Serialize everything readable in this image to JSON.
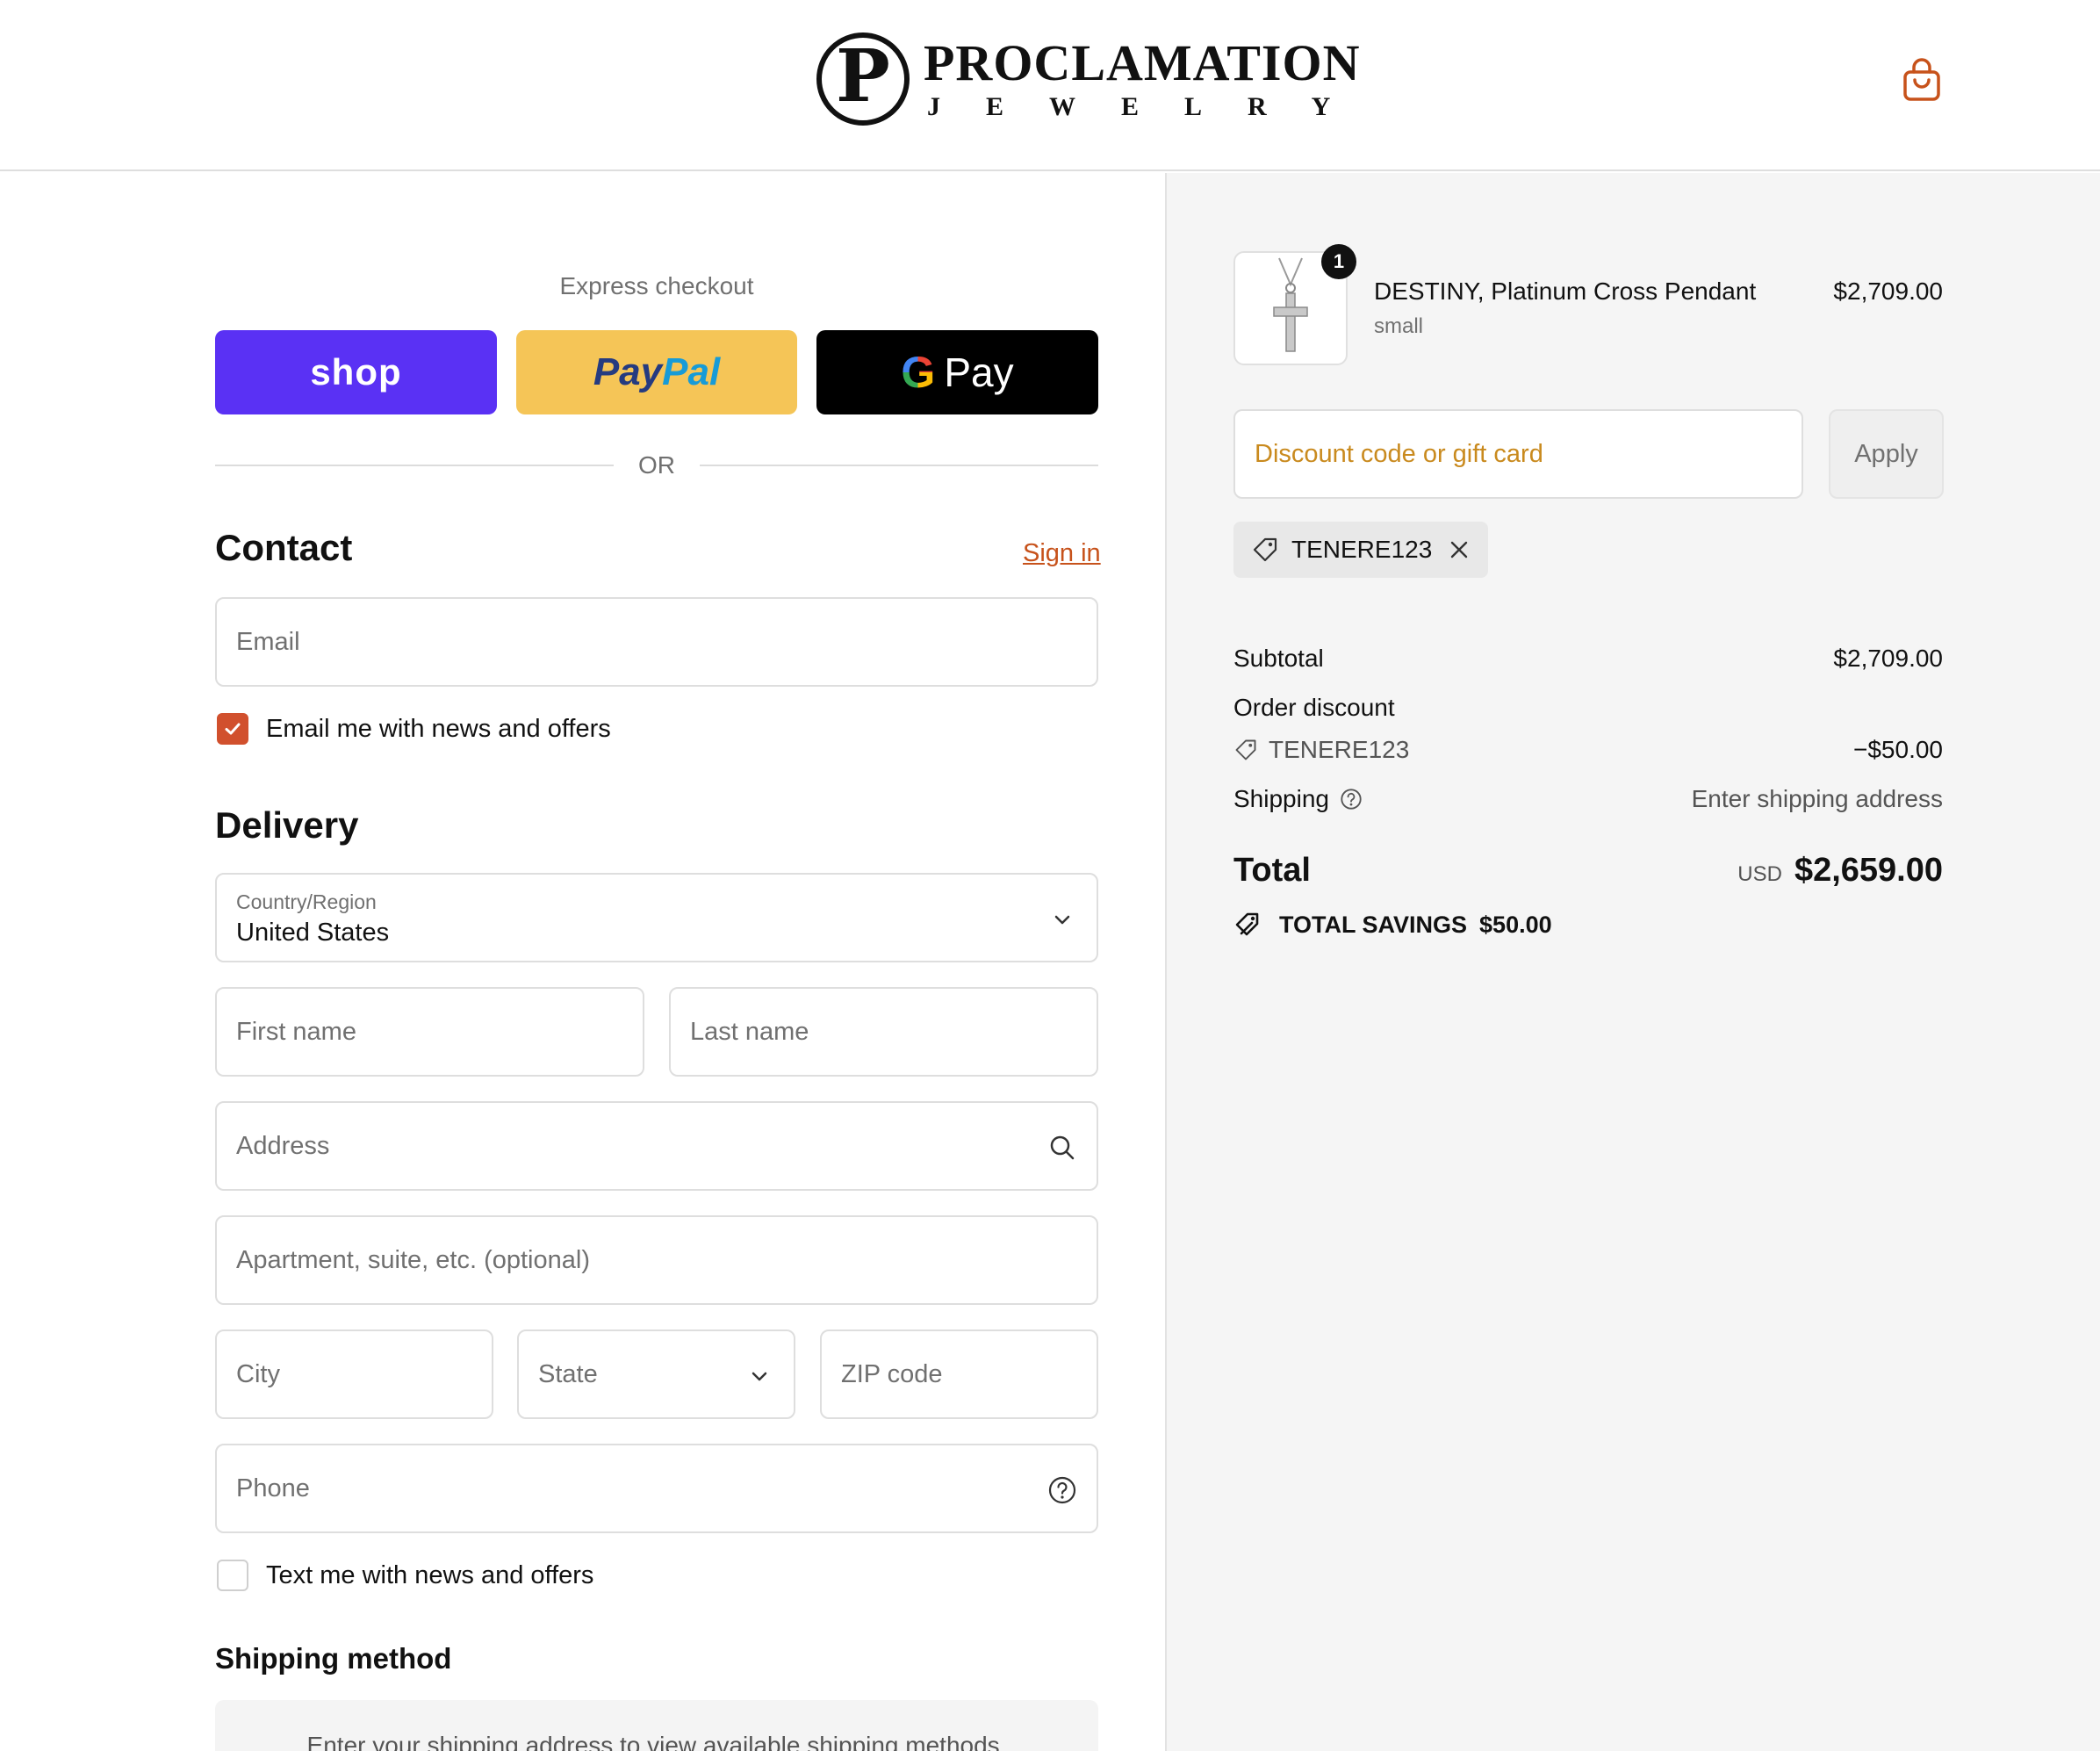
{
  "header": {
    "logo_monogram": "P",
    "logo_name": "PROCLAMATION",
    "logo_sub": "JEWELRY",
    "cart_icon": "shopping-bag-icon"
  },
  "express": {
    "title": "Express checkout",
    "shop_label": "shop",
    "paypal_part1": "Pay",
    "paypal_part2": "Pal",
    "gpay_g": "G",
    "gpay_label": "Pay",
    "or_text": "OR"
  },
  "contact": {
    "title": "Contact",
    "sign_in": "Sign in",
    "email_placeholder": "Email",
    "newsletter_label": "Email me with news and offers",
    "newsletter_checked": true
  },
  "delivery": {
    "title": "Delivery",
    "country_label": "Country/Region",
    "country_value": "United States",
    "first_name_placeholder": "First name",
    "last_name_placeholder": "Last name",
    "address_placeholder": "Address",
    "apartment_placeholder": "Apartment, suite, etc. (optional)",
    "city_placeholder": "City",
    "state_placeholder": "State",
    "zip_placeholder": "ZIP code",
    "phone_placeholder": "Phone",
    "sms_label": "Text me with news and offers",
    "sms_checked": false
  },
  "shipping_method": {
    "title": "Shipping method",
    "note": "Enter your shipping address to view available shipping methods."
  },
  "summary": {
    "product": {
      "quantity": "1",
      "name": "DESTINY, Platinum Cross Pendant",
      "variant": "small",
      "price": "$2,709.00"
    },
    "discount_placeholder": "Discount code or gift card",
    "apply_label": "Apply",
    "applied_code": "TENERE123",
    "subtotal_label": "Subtotal",
    "subtotal_value": "$2,709.00",
    "order_discount_label": "Order discount",
    "order_discount_code": "TENERE123",
    "order_discount_value": "−$50.00",
    "shipping_label": "Shipping",
    "shipping_value": "Enter shipping address",
    "total_label": "Total",
    "total_currency": "USD",
    "total_value": "$2,659.00",
    "savings_label": "TOTAL SAVINGS",
    "savings_value": "$50.00"
  },
  "colors": {
    "accent": "#c7521b",
    "checkbox": "#d1502d",
    "shop_pay": "#5a31f4",
    "paypal": "#f5c557",
    "gpay": "#000000",
    "summary_bg": "#f5f5f5"
  }
}
